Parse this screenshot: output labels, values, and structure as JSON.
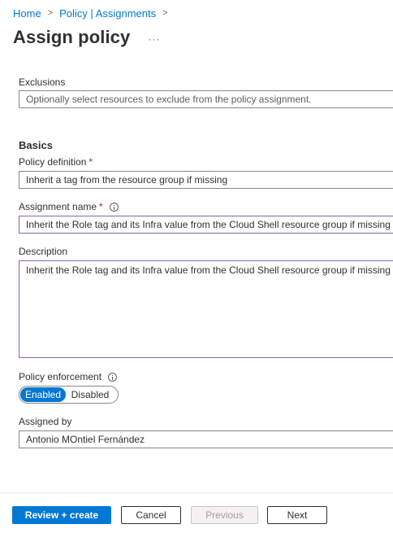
{
  "breadcrumb": {
    "items": [
      "Home",
      "Policy | Assignments"
    ],
    "separator": ">"
  },
  "header": {
    "title": "Assign policy",
    "more": "···"
  },
  "form": {
    "exclusions": {
      "label": "Exclusions",
      "placeholder": "Optionally select resources to exclude from the policy assignment."
    },
    "basics_heading": "Basics",
    "policy_definition": {
      "label": "Policy definition",
      "required_mark": "*",
      "value": "Inherit a tag from the resource group if missing"
    },
    "assignment_name": {
      "label": "Assignment name",
      "required_mark": "*",
      "value": "Inherit the Role tag and its Infra value from the Cloud Shell resource group if missing"
    },
    "description": {
      "label": "Description",
      "value": "Inherit the Role tag and its Infra value from the Cloud Shell resource group if missing"
    },
    "policy_enforcement": {
      "label": "Policy enforcement",
      "options": [
        "Enabled",
        "Disabled"
      ],
      "selected": "Enabled"
    },
    "assigned_by": {
      "label": "Assigned by",
      "value": "Antonio MOntiel Fernández"
    }
  },
  "footer": {
    "review_create": "Review + create",
    "cancel": "Cancel",
    "previous": "Previous",
    "next": "Next"
  },
  "colors": {
    "accent": "#0078d4",
    "focus_border": "#8764b8",
    "required": "#a4262c"
  }
}
